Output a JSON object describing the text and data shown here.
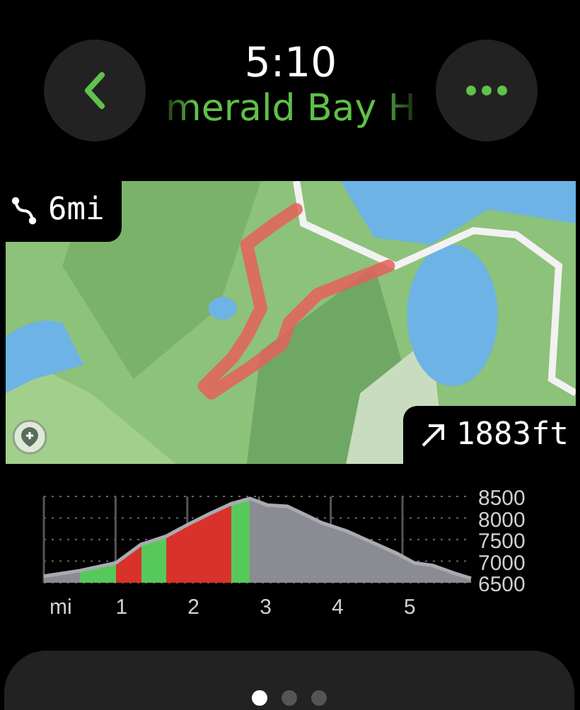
{
  "header": {
    "time": "5:10",
    "title": "merald Bay H"
  },
  "map": {
    "distance": "6mi",
    "elevation_gain": "1883ft"
  },
  "elevation_profile": {
    "x_unit": "mi",
    "chart_data": {
      "type": "area",
      "x": [
        0,
        0.5,
        1,
        1.35,
        1.7,
        2,
        2.3,
        2.6,
        2.86,
        3.1,
        3.38,
        3.6,
        3.84,
        4.2,
        4.62,
        4.9,
        5.14,
        5.4,
        5.7,
        5.93
      ],
      "series": [
        {
          "color": "#8a8b93",
          "values": [
            6650,
            6780,
            6960,
            7390,
            7580,
            7850,
            8100,
            8330,
            8450,
            8300,
            8270,
            8100,
            7900,
            7700,
            7390,
            7180,
            6960,
            6900,
            6720,
            6600
          ]
        }
      ],
      "xlim": [
        0,
        5.93
      ],
      "ylim": [
        6500,
        8500
      ],
      "xticks": [
        1,
        2,
        3,
        4,
        5
      ],
      "yticks": [
        6500,
        7000,
        7500,
        8000,
        8500
      ],
      "grid": true
    }
  },
  "pages": [
    {
      "selected": true
    },
    {
      "selected": false
    },
    {
      "selected": false
    }
  ]
}
